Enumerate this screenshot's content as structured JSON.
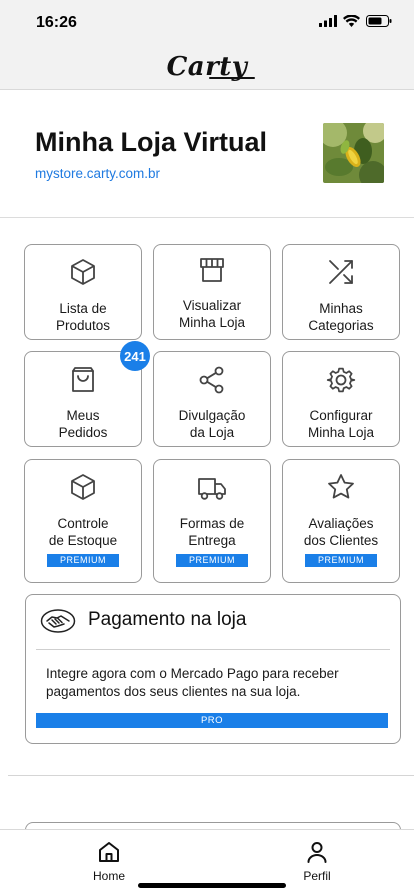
{
  "status_bar": {
    "time": "16:26"
  },
  "header": {
    "logo_text": "Carty"
  },
  "store": {
    "title": "Minha Loja Virtual",
    "url": "mystore.carty.com.br"
  },
  "tiles": [
    {
      "label": "Lista de\nProdutos",
      "icon": "box-icon"
    },
    {
      "label": "Visualizar\nMinha Loja",
      "icon": "storefront-icon"
    },
    {
      "label": "Minhas\nCategorias",
      "icon": "shuffle-icon"
    },
    {
      "label": "Meus\nPedidos",
      "icon": "shopping-bag-icon",
      "badge": "241"
    },
    {
      "label": "Divulgação\nda Loja",
      "icon": "share-icon"
    },
    {
      "label": "Configurar\nMinha Loja",
      "icon": "gear-icon"
    },
    {
      "label": "Controle\nde Estoque",
      "icon": "box-icon",
      "tag": "PREMIUM"
    },
    {
      "label": "Formas de\nEntrega",
      "icon": "truck-icon",
      "tag": "PREMIUM"
    },
    {
      "label": "Avaliações\ndos Clientes",
      "icon": "star-icon",
      "tag": "PREMIUM"
    }
  ],
  "payment_card": {
    "title": "Pagamento na loja",
    "description": "Integre agora com o Mercado Pago para receber pagamentos dos seus clientes na sua loja.",
    "tag": "PRO",
    "icon": "handshake-icon"
  },
  "tab_bar": {
    "home_label": "Home",
    "profile_label": "Perfil"
  },
  "colors": {
    "accent": "#1a7fe8",
    "link": "#1f7ae0",
    "header_bg": "#f2f2f2"
  }
}
